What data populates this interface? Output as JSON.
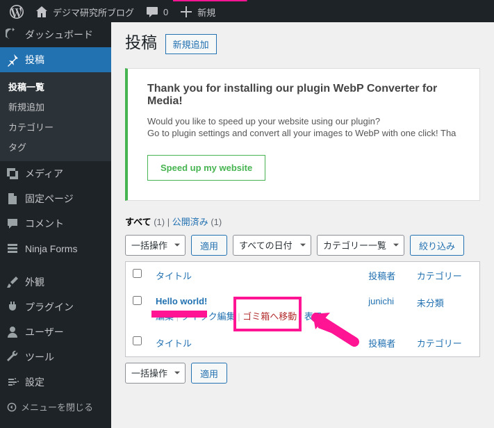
{
  "adminbar": {
    "site_title": "デジマ研究所ブログ",
    "comments_count": "0",
    "new_label": "新規"
  },
  "sidebar": {
    "dashboard": "ダッシュボード",
    "posts": "投稿",
    "submenu": {
      "all": "投稿一覧",
      "new": "新規追加",
      "categories": "カテゴリー",
      "tags": "タグ"
    },
    "media": "メディア",
    "pages": "固定ページ",
    "comments": "コメント",
    "ninja": "Ninja Forms",
    "appearance": "外観",
    "plugins": "プラグイン",
    "users": "ユーザー",
    "tools": "ツール",
    "settings": "設定",
    "collapse": "メニューを閉じる"
  },
  "page": {
    "heading": "投稿",
    "add_new": "新規追加"
  },
  "notice": {
    "title": "Thank you for installing our plugin WebP Converter for Media!",
    "line1": "Would you like to speed up your website using our plugin?",
    "line2": "Go to plugin settings and convert all your images to WebP with one click! Tha",
    "cta": "Speed up my website"
  },
  "filters": {
    "all_label": "すべて",
    "all_count": "(1)",
    "published_label": "公開済み",
    "published_count": "(1)",
    "bulk": "一括操作",
    "apply": "適用",
    "dates": "すべての日付",
    "cats": "カテゴリー一覧",
    "filter_btn": "絞り込み"
  },
  "table": {
    "col_title": "タイトル",
    "col_author": "投稿者",
    "col_cat": "カテゴリー",
    "row": {
      "title": "Hello world!",
      "author": "junichi",
      "cat": "未分類",
      "actions": {
        "edit": "編集",
        "quick": "クイック編集",
        "trash": "ゴミ箱へ移動",
        "view": "表示"
      }
    }
  }
}
